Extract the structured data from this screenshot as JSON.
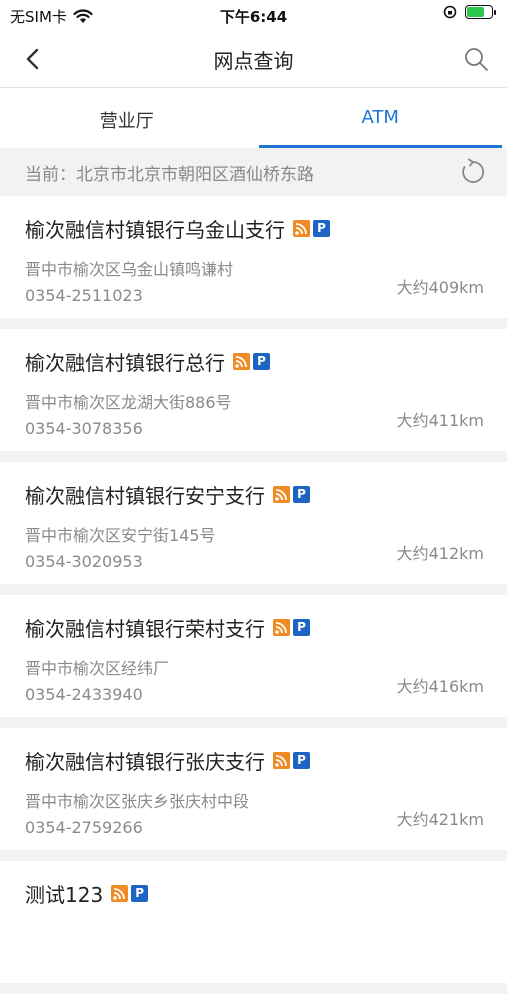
{
  "status_bar": {
    "carrier": "无SIM卡",
    "time": "下午6:44"
  },
  "nav": {
    "title": "网点查询"
  },
  "tabs": [
    {
      "label": "营业厅",
      "active": false
    },
    {
      "label": "ATM",
      "active": true
    }
  ],
  "location": {
    "text": "当前：北京市北京市朝阳区酒仙桥东路"
  },
  "branches": [
    {
      "name": "榆次融信村镇银行乌金山支行",
      "address": "晋中市榆次区乌金山镇鸣谦村",
      "phone": "0354-2511023",
      "distance": "大约409km"
    },
    {
      "name": "榆次融信村镇银行总行",
      "address": "晋中市榆次区龙湖大街886号",
      "phone": "0354-3078356",
      "distance": "大约411km"
    },
    {
      "name": "榆次融信村镇银行安宁支行",
      "address": "晋中市榆次区安宁街145号",
      "phone": "0354-3020953",
      "distance": "大约412km"
    },
    {
      "name": "榆次融信村镇银行荣村支行",
      "address": "晋中市榆次区经纬厂",
      "phone": "0354-2433940",
      "distance": "大约416km"
    },
    {
      "name": "榆次融信村镇银行张庆支行",
      "address": "晋中市榆次区张庆乡张庆村中段",
      "phone": "0354-2759266",
      "distance": "大约421km"
    },
    {
      "name": "测试123",
      "address": "",
      "phone": "",
      "distance": ""
    }
  ],
  "badge_p_label": "P",
  "colors": {
    "accent": "#1f74d6",
    "rss_badge": "#f08b24",
    "parking_badge": "#1e64c3"
  },
  "icons": [
    "wifi-icon",
    "battery-icon",
    "back-icon",
    "search-icon",
    "refresh-icon",
    "rss-icon",
    "parking-icon"
  ]
}
